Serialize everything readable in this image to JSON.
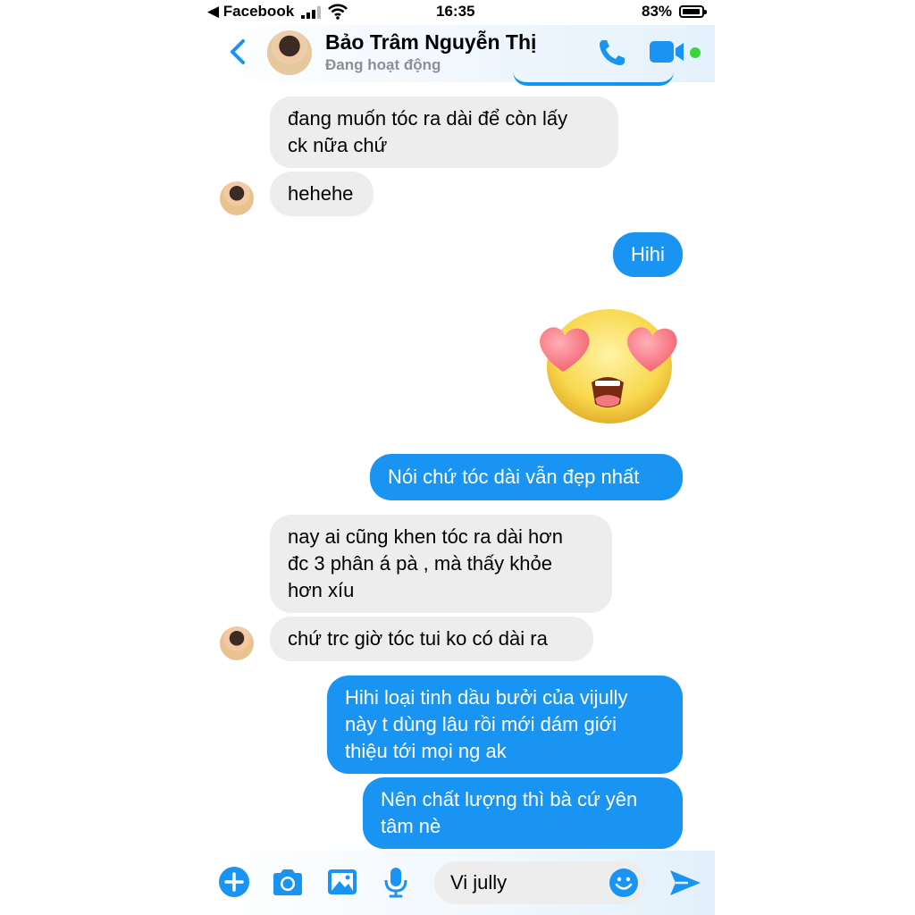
{
  "status_bar": {
    "back_app": "◀ Facebook",
    "time": "16:35",
    "battery": "83%"
  },
  "header": {
    "contact_name": "Bảo Trâm Nguyễn Thị",
    "presence": "Đang hoạt động"
  },
  "messages": [
    {
      "side": "in",
      "text_lines": [
        "đang muốn tóc ra dài để còn lấy",
        "ck nữa chứ"
      ]
    },
    {
      "side": "in",
      "text_lines": [
        "hehehe"
      ]
    },
    {
      "side": "out",
      "text_lines": [
        "Hihi"
      ]
    },
    {
      "side": "out",
      "emoji": "heart-eyes"
    },
    {
      "side": "out",
      "text_lines": [
        "Nói chứ tóc dài vẫn đẹp nhất"
      ]
    },
    {
      "side": "in",
      "text_lines": [
        "nay ai cũng khen tóc ra dài hơn",
        "đc 3 phân á pà , mà thấy khỏe",
        "hơn xíu"
      ]
    },
    {
      "side": "in",
      "text_lines": [
        "chứ trc giờ tóc tui ko có dài ra"
      ]
    },
    {
      "side": "out",
      "text_lines": [
        "Hihi loại tinh dầu bưởi của vijully",
        "này t dùng lâu rồi mới dám giới",
        "thiệu tới mọi ng ak"
      ]
    },
    {
      "side": "out",
      "text_lines": [
        "Nên chất lượng thì bà cứ yên",
        "tâm nè"
      ]
    }
  ],
  "composer": {
    "input_value": "Vi jully",
    "icons": [
      "plus-icon",
      "camera-icon",
      "image-icon",
      "microphone-icon",
      "emoji-icon",
      "send-icon"
    ]
  },
  "colors": {
    "accent": "#1a94f3",
    "incoming_bubble": "#ededed",
    "online": "#3cd53c"
  }
}
